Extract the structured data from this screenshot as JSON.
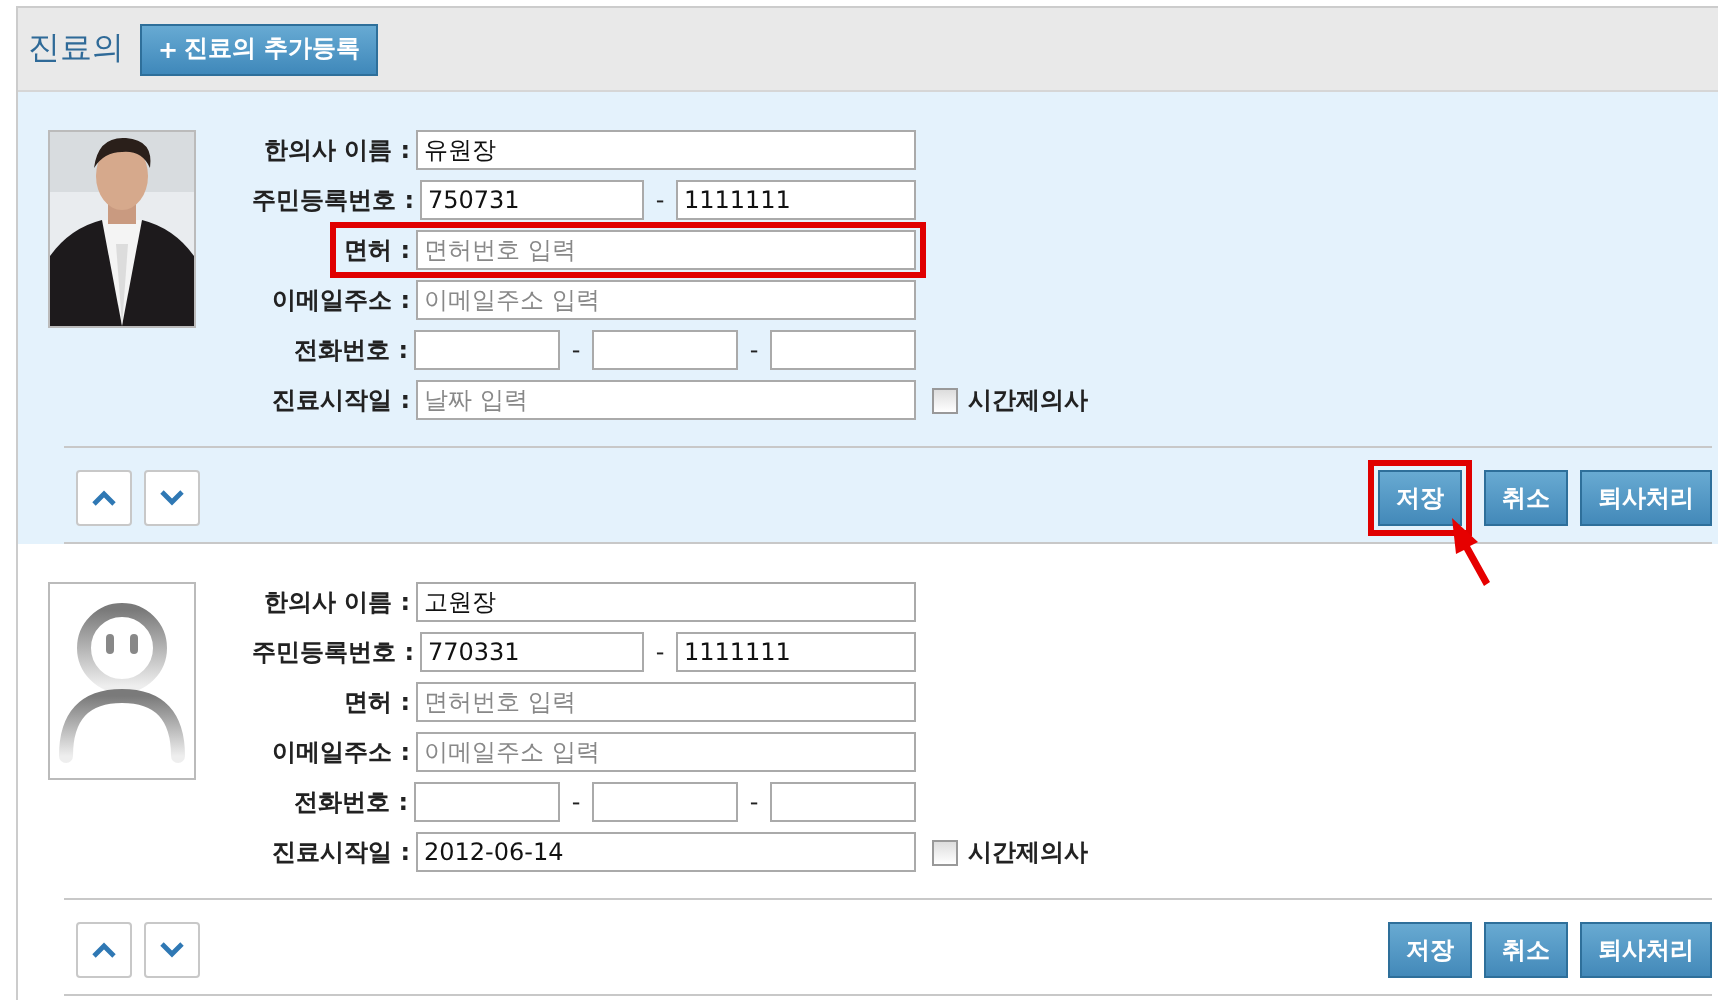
{
  "header": {
    "title": "진료의",
    "add_button": {
      "icon": "+",
      "label": "진료의 추가등록"
    }
  },
  "doctors": [
    {
      "selected": true,
      "fields": [
        {
          "kind": "single",
          "label": "한의사 이름 :",
          "highlighted": false,
          "parts": [
            {
              "value": "유원장"
            }
          ]
        },
        {
          "kind": "split",
          "label": "주민등록번호 :",
          "highlighted": false,
          "separator": "-",
          "parts": [
            {
              "value": "750731"
            },
            {
              "value": "1111111"
            }
          ]
        },
        {
          "kind": "single",
          "label": "면허 :",
          "highlighted": true,
          "parts": [
            {
              "placeholder": "면허번호 입력"
            }
          ]
        },
        {
          "kind": "single",
          "label": "이메일주소 :",
          "highlighted": false,
          "parts": [
            {
              "placeholder": "이메일주소 입력"
            }
          ]
        },
        {
          "kind": "phone",
          "label": "전화번호 :",
          "highlighted": false,
          "separator": "-"
        },
        {
          "kind": "date",
          "label": "진료시작일 :",
          "highlighted": false,
          "parts": [
            {
              "placeholder": "날짜 입력"
            }
          ],
          "checkbox": {
            "label": "시간제의사",
            "checked": false
          }
        }
      ],
      "buttons": [
        {
          "label": "저장",
          "highlighted": true
        },
        {
          "label": "취소",
          "highlighted": false
        },
        {
          "label": "퇴사처리",
          "highlighted": false
        }
      ]
    },
    {
      "selected": false,
      "photo": {
        "kind": "avatar"
      },
      "fields": [
        {
          "kind": "single",
          "label": "한의사 이름 :",
          "highlighted": false,
          "parts": [
            {
              "value": "고원장"
            }
          ]
        },
        {
          "kind": "split",
          "label": "주민등록번호 :",
          "highlighted": false,
          "separator": "-",
          "parts": [
            {
              "value": "770331"
            },
            {
              "value": "1111111"
            }
          ]
        },
        {
          "kind": "single",
          "label": "면허 :",
          "highlighted": false,
          "parts": [
            {
              "placeholder": "면허번호 입력"
            }
          ]
        },
        {
          "kind": "single",
          "label": "이메일주소 :",
          "highlighted": false,
          "parts": [
            {
              "placeholder": "이메일주소 입력"
            }
          ]
        },
        {
          "kind": "phone",
          "label": "전화번호 :",
          "highlighted": false,
          "separator": "-"
        },
        {
          "kind": "date",
          "label": "진료시작일 :",
          "highlighted": false,
          "parts": [
            {
              "value": "2012-06-14"
            }
          ],
          "checkbox": {
            "label": "시간제의사",
            "checked": false
          }
        }
      ],
      "buttons": [
        {
          "label": "저장",
          "highlighted": false
        },
        {
          "label": "취소",
          "highlighted": false
        },
        {
          "label": "퇴사처리",
          "highlighted": false
        }
      ]
    }
  ]
}
